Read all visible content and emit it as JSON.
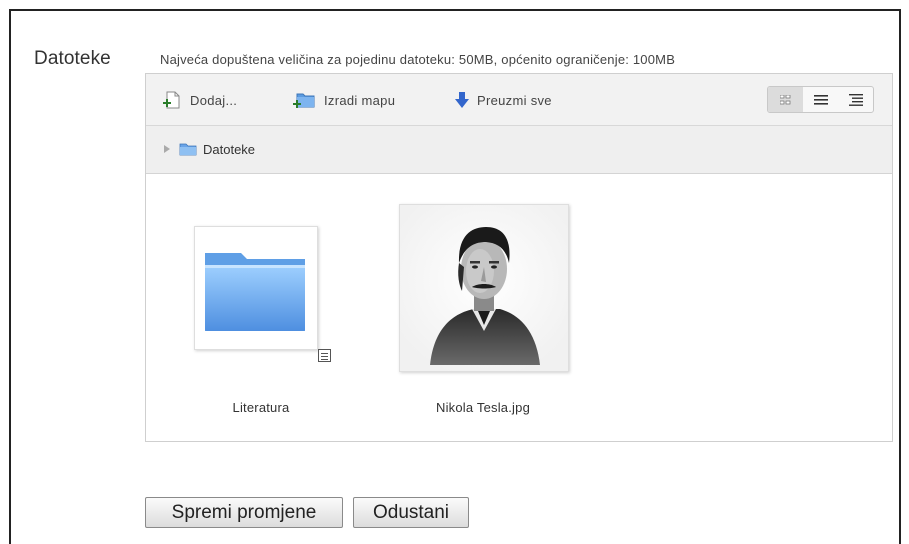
{
  "form": {
    "label": "Datoteke",
    "limits": "Najveća dopuštena veličina za pojedinu datoteku: 50MB, općenito ograničenje: 100MB"
  },
  "toolbar": {
    "add_label": "Dodaj...",
    "mkdir_label": "Izradi mapu",
    "download_all_label": "Preuzmi sve",
    "view_modes": [
      "icons",
      "list",
      "tree"
    ],
    "active_view": "icons"
  },
  "breadcrumb": {
    "root_label": "Datoteke"
  },
  "files": [
    {
      "name": "Literatura",
      "type": "folder"
    },
    {
      "name": "Nikola Tesla.jpg",
      "type": "image"
    }
  ],
  "buttons": {
    "save_label": "Spremi promjene",
    "cancel_label": "Odustani"
  },
  "colors": {
    "folder": "#6aa4e8",
    "download_arrow": "#3366cc",
    "toolbar_bg": "#f2f2f2"
  }
}
